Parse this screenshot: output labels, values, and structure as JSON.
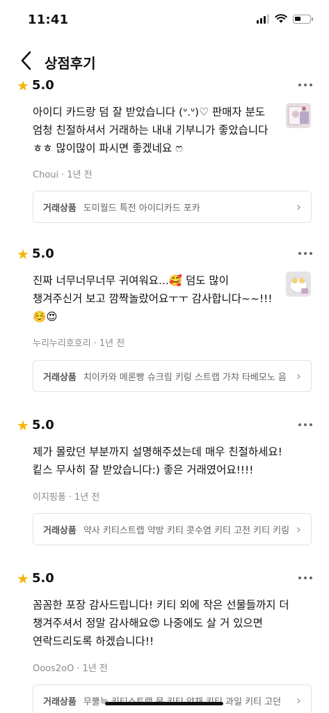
{
  "status": {
    "time": "11:41"
  },
  "header": {
    "title": "상점후기"
  },
  "reviews": [
    {
      "score": "5.0",
      "text": "아이디 카드랑 덤 잘 받았습니다 (ᐡ.ᐡ)♡ 판매자 분도 엄청 친절하셔서 거래하는 내내 기부니가 좋았습니다 ㅎㅎ 많이많이 파시면 좋겠네요 ෆ",
      "author": "Choui",
      "date": "1년 전",
      "product_label": "거래상품",
      "product": "도미월드 특전 아이디카드 포카"
    },
    {
      "score": "5.0",
      "text": "진짜 너무너무너무 귀여워요...🥰 덤도 많이 챙겨주신거 보고 깜짝놀랐어요ㅜㅜ 감사합니다~~!!!☺️😍",
      "author": "누리누리호호리",
      "date": "1년 전",
      "product_label": "거래상품",
      "product": "치이카와 메론빵 슈크림 키링 스트랩 가챠 타베모노 음"
    },
    {
      "score": "5.0",
      "text": "제가 몰랐던 부분까지 설명해주셨는데 매우 친절하세요! 킽스 무사히 잘 받았습니다:) 좋은 거래였어요!!!!",
      "author": "이지핑퐁",
      "date": "1년 전",
      "product_label": "거래상품",
      "product": "약사 키티스트랩 약방 키티 콧수염 키티 고전 키티 키링"
    },
    {
      "score": "5.0",
      "text": "꼼꼼한 포장 감사드립니다! 키티 외에 작은 선물들까지 더 챙겨주셔서 정말 감사해요😍 나중에도 살 거 있으면 연락드리도록 하겠습니다!!",
      "author": "Ooos2oO",
      "date": "1년 전",
      "product_label": "거래상품",
      "product": "무뿔늑 키티스트랩 뭉 키티 약채 키티 과일 키티 고던"
    }
  ]
}
